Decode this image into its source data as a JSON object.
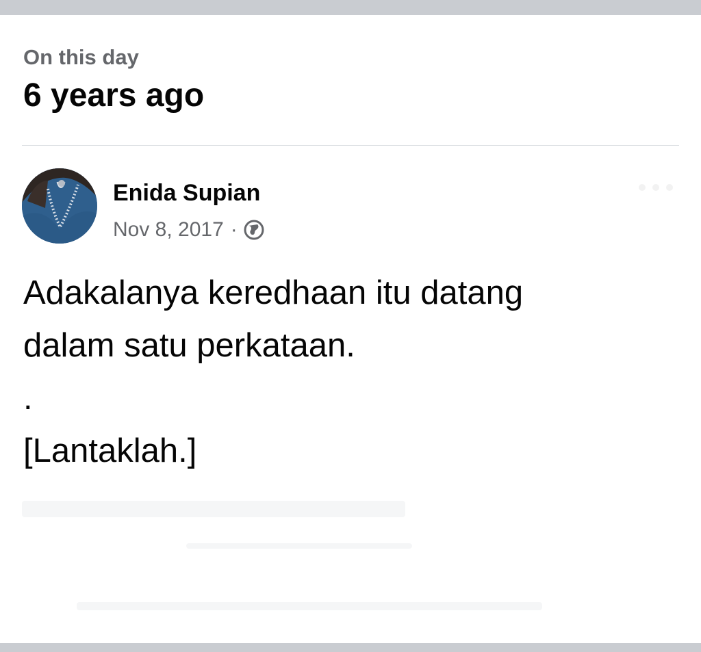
{
  "memory": {
    "label": "On this day",
    "title": "6 years ago"
  },
  "post": {
    "author": "Enida Supian",
    "date": "Nov 8, 2017",
    "separator": "·",
    "privacy_icon": "globe-icon",
    "lines": [
      "Adakalanya keredhaan itu datang",
      "dalam satu perkataan.",
      ".",
      "[Lantaklah.]"
    ]
  },
  "colors": {
    "background_frame": "#c9ccd1",
    "card": "#ffffff",
    "primary_text": "#050505",
    "secondary_text": "#65676b",
    "divider": "#dadde1",
    "avatar_blue": "#2f5f8d"
  }
}
